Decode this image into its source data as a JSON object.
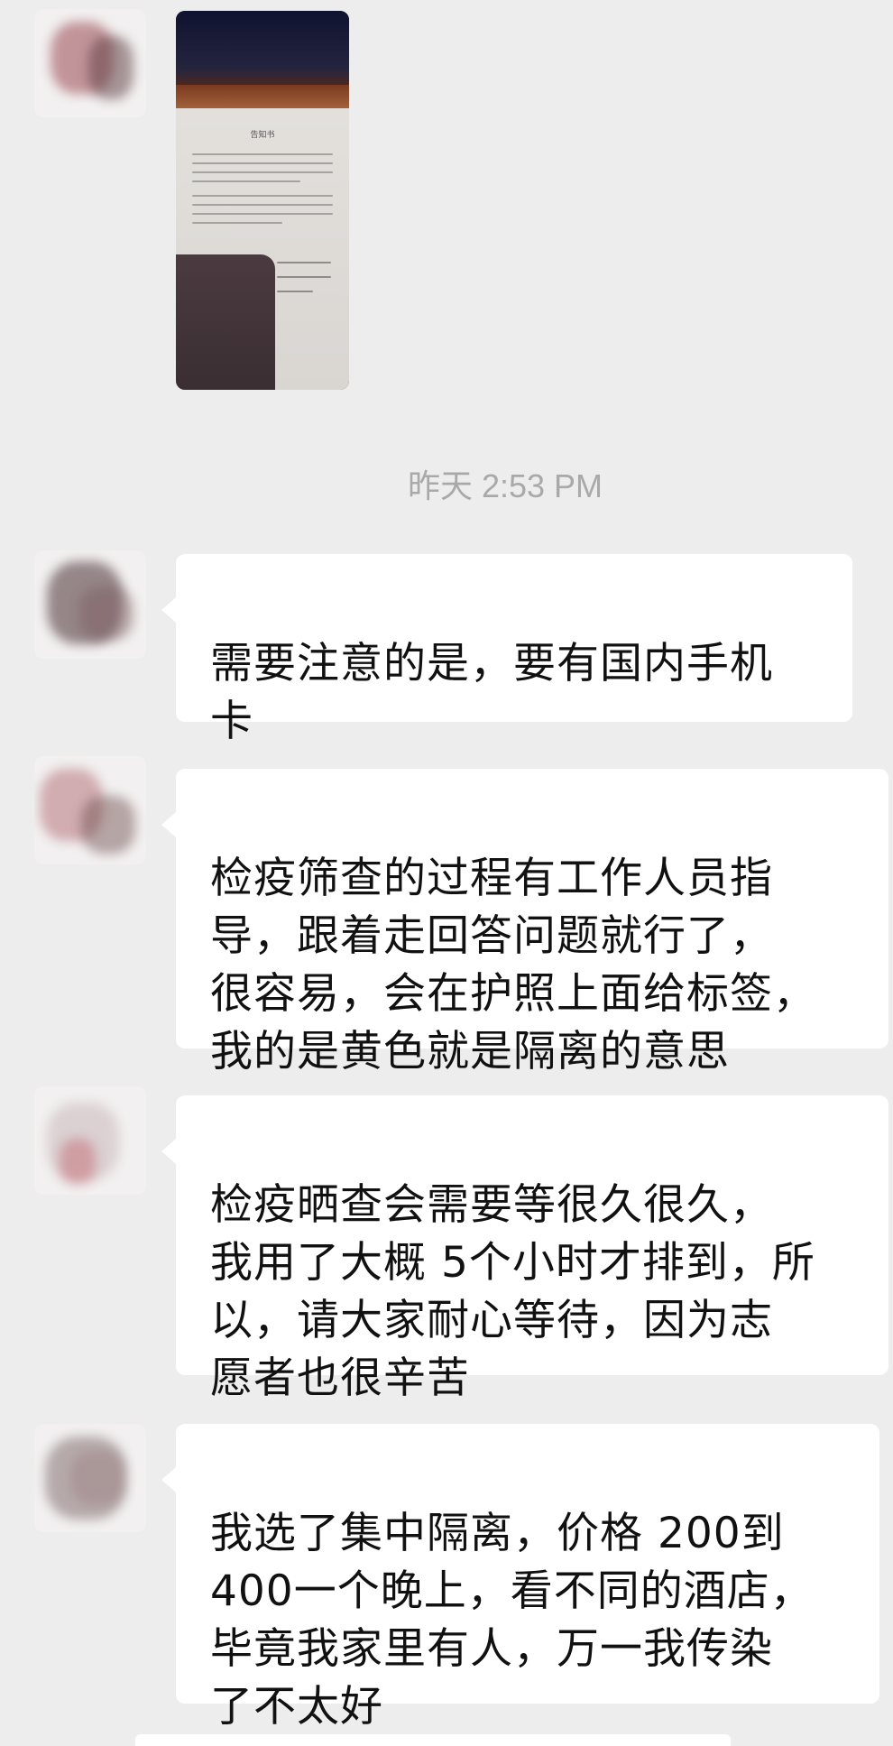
{
  "chat": {
    "image_message": {
      "document_title": "告知书"
    },
    "timestamp": "昨天 2:53 PM",
    "messages": [
      {
        "text": "需要注意的是，要有国内手机\n卡"
      },
      {
        "text": "检疫筛查的过程有工作人员指\n导，跟着走回答问题就行了，\n很容易，会在护照上面给标签，\n我的是黄色就是隔离的意思"
      },
      {
        "text": "检疫晒查会需要等很久很久，\n我用了大概 5个小时才排到，所\n以，请大家耐心等待，因为志\n愿者也很辛苦"
      },
      {
        "text": "我选了集中隔离，价格 200到\n400一个晚上，看不同的酒店，\n毕竟我家里有人，万一我传染\n了不太好"
      }
    ]
  },
  "colors": {
    "background": "#ededed",
    "bubble": "#ffffff",
    "text": "#111111",
    "timestamp": "#a9a9a9"
  }
}
